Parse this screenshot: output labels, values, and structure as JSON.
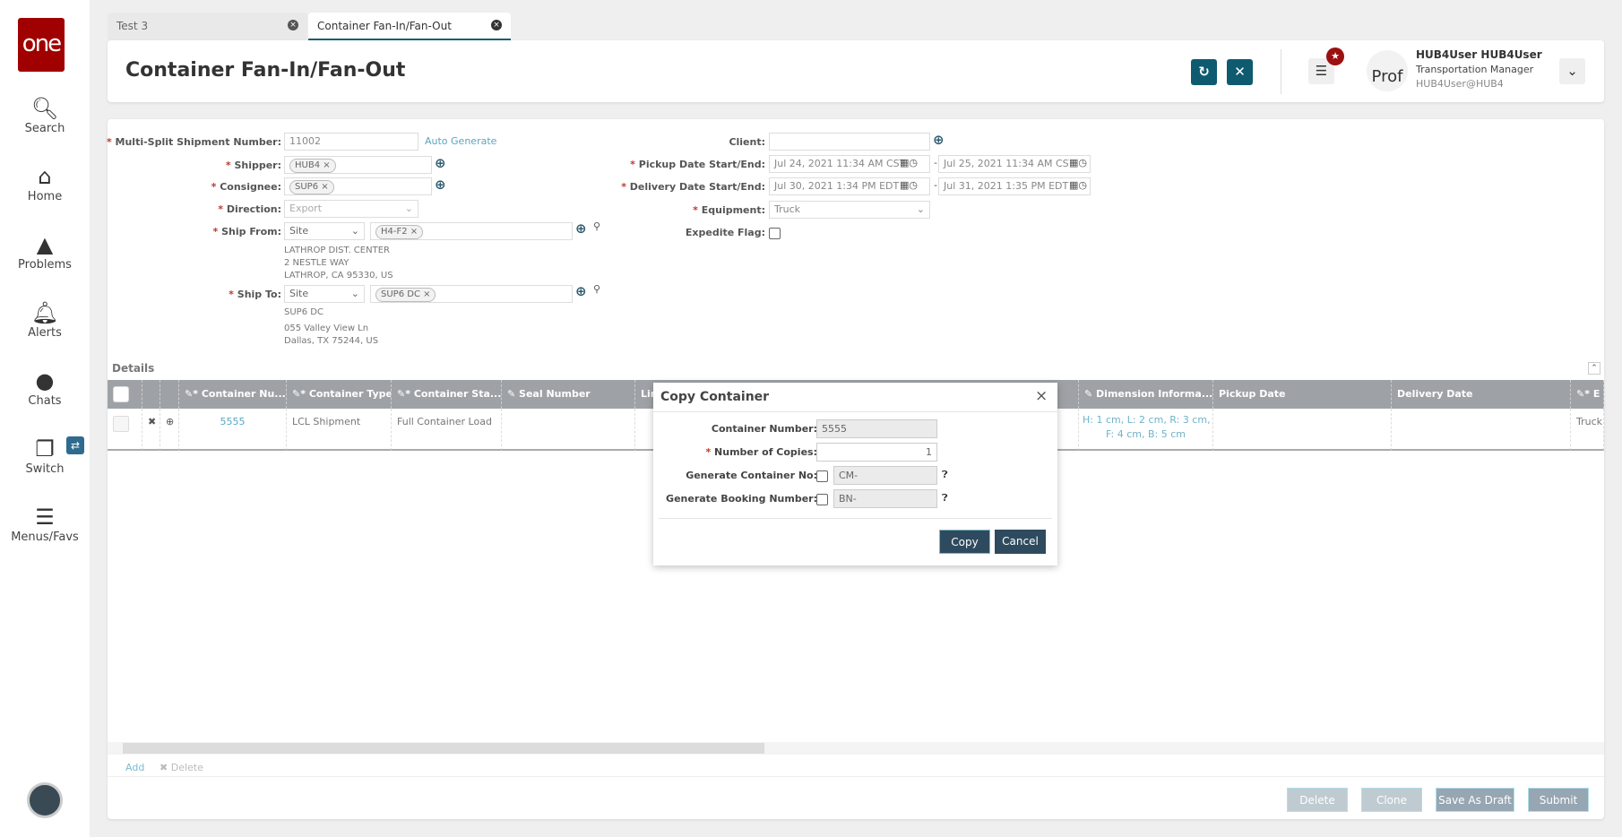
{
  "sidebar": {
    "logo": "one",
    "items": [
      {
        "label": "Search",
        "icon": "search-icon"
      },
      {
        "label": "Home",
        "icon": "home-icon"
      },
      {
        "label": "Problems",
        "icon": "warning-icon"
      },
      {
        "label": "Alerts",
        "icon": "bell-icon"
      },
      {
        "label": "Chats",
        "icon": "chat-icon"
      },
      {
        "label": "Switch",
        "icon": "switch-icon"
      },
      {
        "label": "Menus/Favs",
        "icon": "menu-icon"
      }
    ]
  },
  "tabs": [
    {
      "label": "Test 3"
    },
    {
      "label": "Container Fan-In/Fan-Out",
      "active": true
    }
  ],
  "header": {
    "title": "Container Fan-In/Fan-Out",
    "user_name": "HUB4User HUB4User",
    "user_role": "Transportation Manager",
    "user_id": "HUB4User@HUB4",
    "avatar_text": "Prof"
  },
  "form": {
    "shipment_number_label": "Multi-Split Shipment Number:",
    "shipment_number": "11002",
    "auto_generate": "Auto Generate",
    "shipper_label": "Shipper:",
    "shipper": "HUB4",
    "consignee_label": "Consignee:",
    "consignee": "SUP6",
    "direction_label": "Direction:",
    "direction": "Export",
    "ship_from_label": "Ship From:",
    "ship_from_type": "Site",
    "ship_from": "H4-F2",
    "ship_from_addr": [
      "LATHROP DIST. CENTER",
      "2 NESTLE WAY",
      "LATHROP, CA 95330, US"
    ],
    "ship_to_label": "Ship To:",
    "ship_to_type": "Site",
    "ship_to": "SUP6 DC",
    "ship_to_addr": [
      "SUP6 DC",
      "055 Valley View Ln",
      "Dallas, TX 75244, US"
    ],
    "client_label": "Client:",
    "client": "",
    "pickup_label": "Pickup Date Start/End:",
    "pickup_start": "Jul 24, 2021 11:34 AM CST",
    "pickup_end": "Jul 25, 2021 11:34 AM CST",
    "delivery_label": "Delivery Date Start/End:",
    "delivery_start": "Jul 30, 2021 1:34 PM EDT",
    "delivery_end": "Jul 31, 2021 1:35 PM EDT",
    "equipment_label": "Equipment:",
    "equipment": "Truck",
    "expedite_label": "Expedite Flag:"
  },
  "details": {
    "title": "Details",
    "columns": [
      "Container Nu...",
      "Container Type",
      "Container Sta...",
      "Seal Number",
      "Lin",
      "Dimension Informa...",
      "Pickup Date",
      "Delivery Date",
      "E"
    ],
    "row": {
      "container_number": "5555",
      "container_type": "LCL Shipment",
      "container_status": "Full Container Load",
      "dimension_1": "H: 1 cm, L: 2 cm, R: 3 cm,",
      "dimension_2": "F: 4 cm, B: 5 cm",
      "equipment": "Truck"
    },
    "add": "Add",
    "delete": "Delete"
  },
  "modal": {
    "title": "Copy Container",
    "container_number_label": "Container Number:",
    "container_number": "5555",
    "copies_label": "Number of Copies:",
    "copies": "1",
    "gen_container_label": "Generate Container No:",
    "gen_container_prefix": "CM-",
    "gen_booking_label": "Generate Booking Number:",
    "gen_booking_prefix": "BN-",
    "copy": "Copy",
    "cancel": "Cancel"
  },
  "footer": {
    "delete": "Delete",
    "clone": "Clone",
    "save_draft": "Save As Draft",
    "submit": "Submit"
  },
  "colors": {
    "brand": "#a00000",
    "accent": "#0e5b70",
    "table_header": "#9ea2a6"
  }
}
